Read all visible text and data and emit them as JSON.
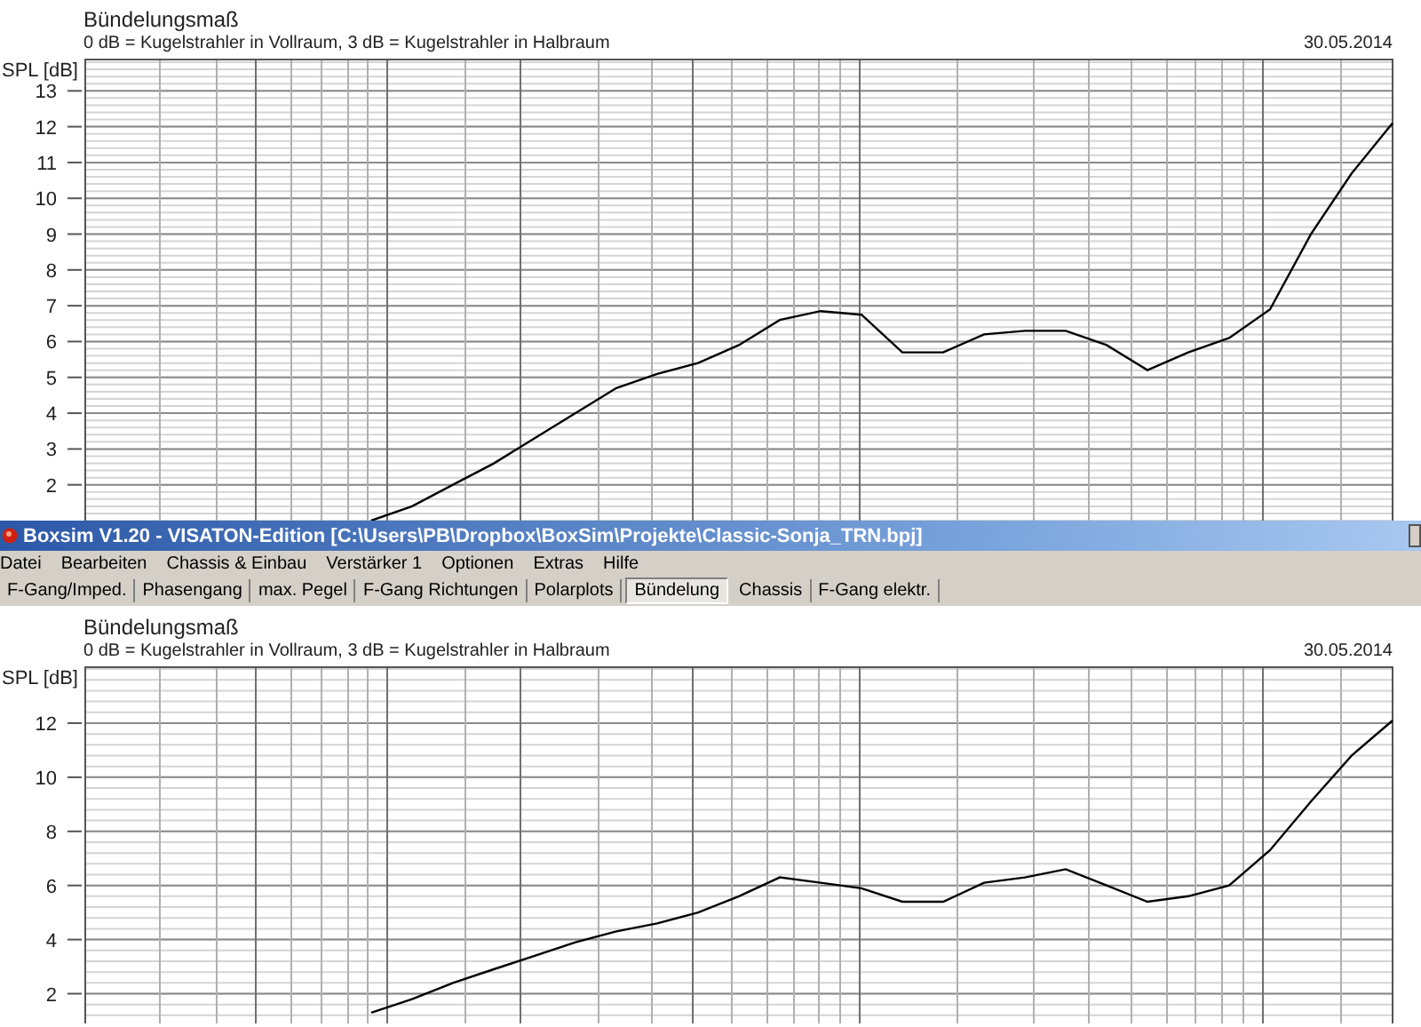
{
  "top_chart": {
    "subtitle": "0 dB = Kugelstrahler in Vollraum, 3 dB = Kugelstrahler in Halbraum",
    "date": "30.05.2014",
    "chart_data": {
      "type": "line",
      "title": "Bündelungsmaß",
      "ylabel": "SPL [dB]",
      "grid": true,
      "ylim": [
        1,
        13.9
      ],
      "yticks": [
        2,
        3,
        4,
        5,
        6,
        7,
        8,
        9,
        10,
        11,
        12,
        13
      ],
      "series": [
        {
          "color": "#000000",
          "values": [
            null,
            null,
            null,
            null,
            null,
            null,
            null,
            1.0,
            1.4,
            2.0,
            2.6,
            3.3,
            4.0,
            4.7,
            5.1,
            5.4,
            5.9,
            6.6,
            6.85,
            6.75,
            5.7,
            5.7,
            6.2,
            6.3,
            6.3,
            5.9,
            5.2,
            5.7,
            6.1,
            6.9,
            9.0,
            10.7,
            12.1
          ]
        }
      ]
    }
  },
  "window": {
    "title": "Boxsim V1.20 - VISATON-Edition [C:\\Users\\PB\\Dropbox\\BoxSim\\Projekte\\Classic-Sonja_TRN.bpj]",
    "menu": [
      "Datei",
      "Bearbeiten",
      "Chassis & Einbau",
      "Verstärker 1",
      "Optionen",
      "Extras",
      "Hilfe"
    ],
    "tabs": [
      {
        "label": "F-Gang/Imped.",
        "selected": false
      },
      {
        "label": "Phasengang",
        "selected": false
      },
      {
        "label": "max. Pegel",
        "selected": false
      },
      {
        "label": "F-Gang Richtungen",
        "selected": false
      },
      {
        "label": "Polarplots",
        "selected": false
      },
      {
        "label": "Bündelung",
        "selected": true
      },
      {
        "label": "Chassis",
        "selected": false
      },
      {
        "label": "F-Gang elektr.",
        "selected": false
      }
    ],
    "chart": {
      "subtitle": "0 dB = Kugelstrahler in Vollraum, 3 dB = Kugelstrahler in Halbraum",
      "date": "30.05.2014",
      "chart_data": {
        "type": "line",
        "title": "Bündelungsmaß",
        "ylabel": "SPL [dB]",
        "grid": true,
        "ylim": [
          0.9,
          14.1
        ],
        "yticks": [
          2,
          4,
          6,
          8,
          10,
          12
        ],
        "series": [
          {
            "color": "#000000",
            "values": [
              null,
              null,
              null,
              null,
              null,
              null,
              null,
              1.3,
              1.8,
              2.4,
              2.9,
              3.4,
              3.9,
              4.3,
              4.6,
              5.0,
              5.6,
              6.3,
              6.1,
              5.9,
              5.4,
              5.4,
              6.1,
              6.3,
              6.6,
              6.0,
              5.4,
              5.6,
              6.0,
              7.3,
              9.1,
              10.8,
              12.1
            ]
          }
        ]
      }
    }
  }
}
